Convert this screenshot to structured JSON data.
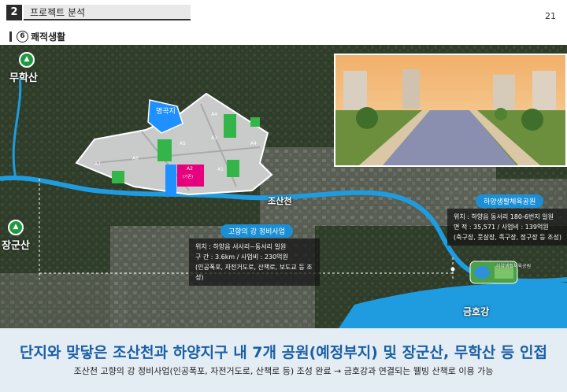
{
  "header": {
    "section_number": "2",
    "section_title": "프로젝트 분석",
    "page_number": "21"
  },
  "subheading": {
    "circled_number": "6",
    "title": "쾌적생활"
  },
  "map": {
    "mountains": [
      "무학산",
      "장군산"
    ],
    "river_main": "조산천",
    "river_south": "금호강",
    "pond_label": "명곡지",
    "blocks": [
      "A4",
      "A3",
      "A5",
      "A6",
      "A7",
      "A2",
      "A1",
      "A4"
    ],
    "block_a2_caption": "(기존)",
    "stadium_pill": "하양생활체육공원",
    "stadium_small_label": "하양생활체육공원",
    "stadium_info": [
      "위치 : 하양읍 동서리 180-6번지 일원",
      "면 적 : 35,571 / 사업비 : 139억원",
      "(축구장, 풋살장, 족구장, 정구장 등 조성)"
    ],
    "project_pill": "고향의 강 정비사업",
    "project_info": [
      "위치 : 하양읍 서사리~동서리 일원",
      "구 간 : 3.6km / 사업비 : 230억원",
      "(인공폭포, 자전거도로, 산책로, 보도교 등 조성)"
    ]
  },
  "footer": {
    "headline": "단지와 맞닿은 조산천과 하양지구 내 7개 공원(예정부지) 및 장군산, 무학산 등 인접",
    "subline": "조산천 고향의 강 정비사업(인공폭포, 자전거도로, 산책로 등) 조성 완료 → 금호강과 연결되는 웰빙 산책로 이용 가능"
  },
  "colors": {
    "river": "#1f9ce0",
    "park": "#33b54a",
    "accent_blue": "#1a5fa6",
    "block_a2": "#e6007e"
  },
  "icons": [
    "mountain-pin-icon",
    "tree-icon",
    "dashed-range-arrow-icon"
  ]
}
